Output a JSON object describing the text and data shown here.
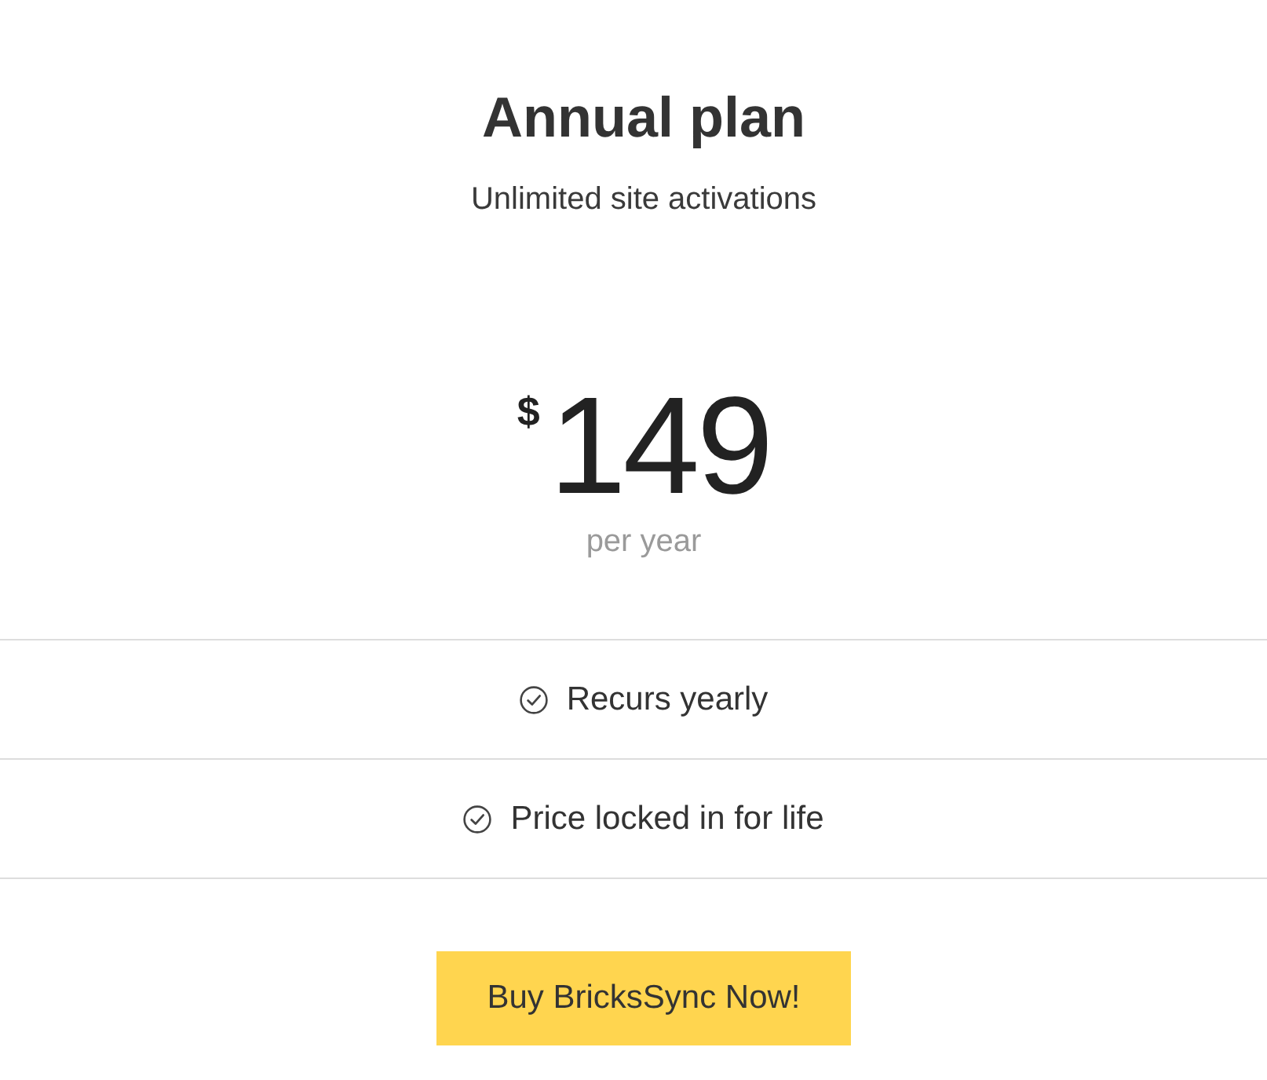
{
  "plan": {
    "title": "Annual plan",
    "subtitle": "Unlimited site activations"
  },
  "price": {
    "currency": "$",
    "amount": "149",
    "period": "per year"
  },
  "features": [
    {
      "label": "Recurs yearly"
    },
    {
      "label": "Price locked in for life"
    }
  ],
  "button": {
    "label": "Buy BricksSync Now!"
  }
}
